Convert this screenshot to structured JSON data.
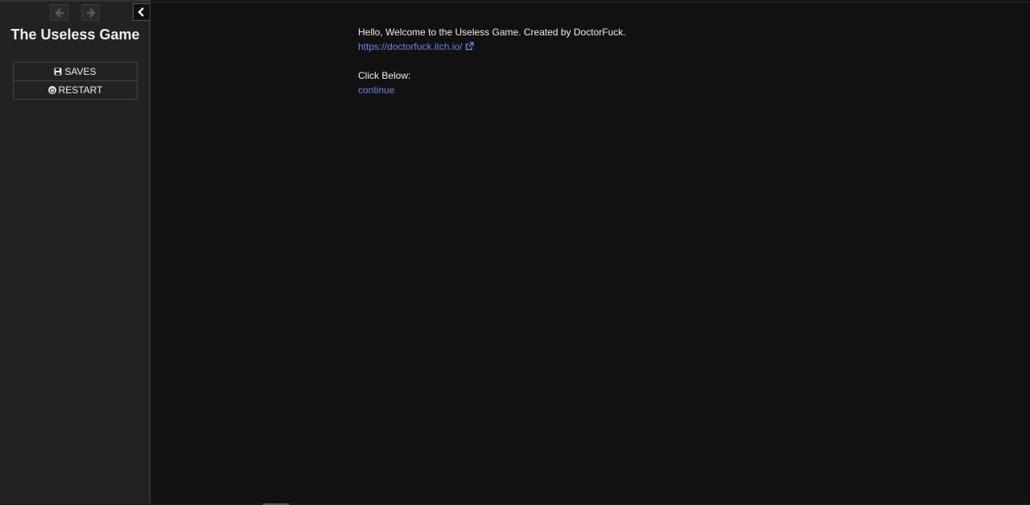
{
  "sidebar": {
    "title": "The Useless Game",
    "saves_label": "SAVES",
    "restart_label": "RESTART"
  },
  "passage": {
    "intro": "Hello, Welcome to the Useless Game. Created by DoctorFuck.",
    "link_url": "https://doctorfuck.itch.io/",
    "prompt": "Click Below:",
    "continue_label": "continue"
  },
  "colors": {
    "link": "#6688dd",
    "sidebar_bg": "#222222",
    "story_bg": "#111111"
  }
}
